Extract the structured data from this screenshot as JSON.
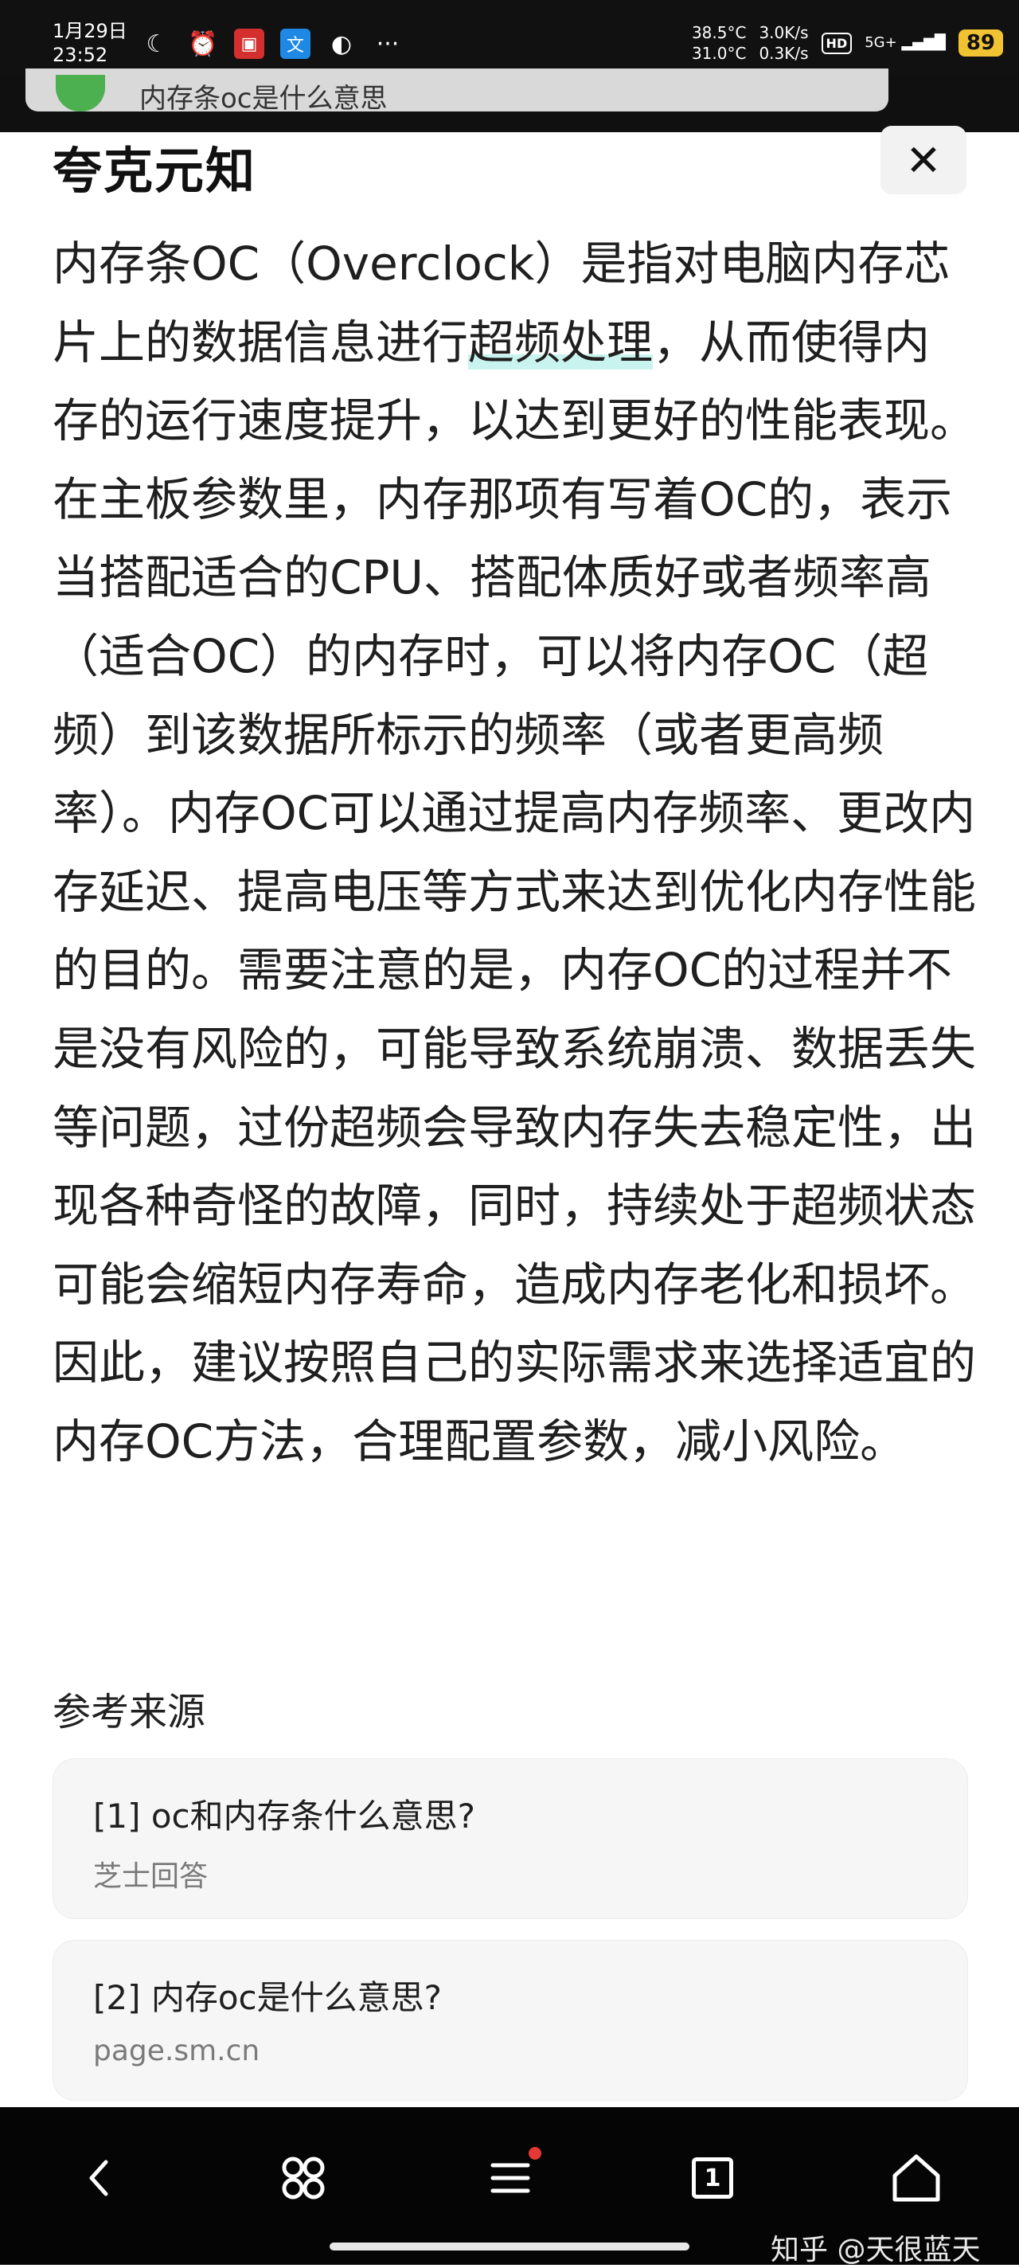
{
  "status_bar": {
    "date": "1月29日",
    "time": "23:52",
    "temp_1": "38.5°C",
    "temp_2": "31.0°C",
    "speed_up": "3.0K/s",
    "speed_down": "0.3K/s",
    "hd_label": "HD",
    "network_label": "5G+",
    "battery": "89",
    "more": "···"
  },
  "search": {
    "query": "内存条oc是什么意思"
  },
  "header": {
    "brand": "夸克元知",
    "close_icon": "close-icon"
  },
  "answer": {
    "part_1": "内存条OC（Overclock）是指对电脑内存芯片上的数据信息进行",
    "highlight": "超频处理",
    "part_2": "，从而使得内存的运行速度提升，以达到更好的性能表现。在主板参数里，内存那项有写着OC的，表示当搭配适合的CPU、搭配体质好或者频率高（适合OC）的内存时，可以将内存OC（超频）到该数据所标示的频率（或者更高频率）。内存OC可以通过提高内存频率、更改内存延迟、提高电压等方式来达到优化内存性能的目的。需要注意的是，内存OC的过程并不是没有风险的，可能导致系统崩溃、数据丢失等问题，过份超频会导致内存失去稳定性，出现各种奇怪的故障，同时，持续处于超频状态可能会缩短内存寿命，造成内存老化和损坏。因此，建议按照自己的实际需求来选择适宜的内存OC方法，合理配置参数，减小风险。"
  },
  "references": {
    "title": "参考来源",
    "items": [
      {
        "title": "[1] oc和内存条什么意思?",
        "source": "芝士回答"
      },
      {
        "title": "[2] 内存oc是什么意思?",
        "source": "page.sm.cn"
      }
    ]
  },
  "bottom_nav": {
    "tab_count": "1",
    "watermark": "知乎 @天很蓝天"
  }
}
